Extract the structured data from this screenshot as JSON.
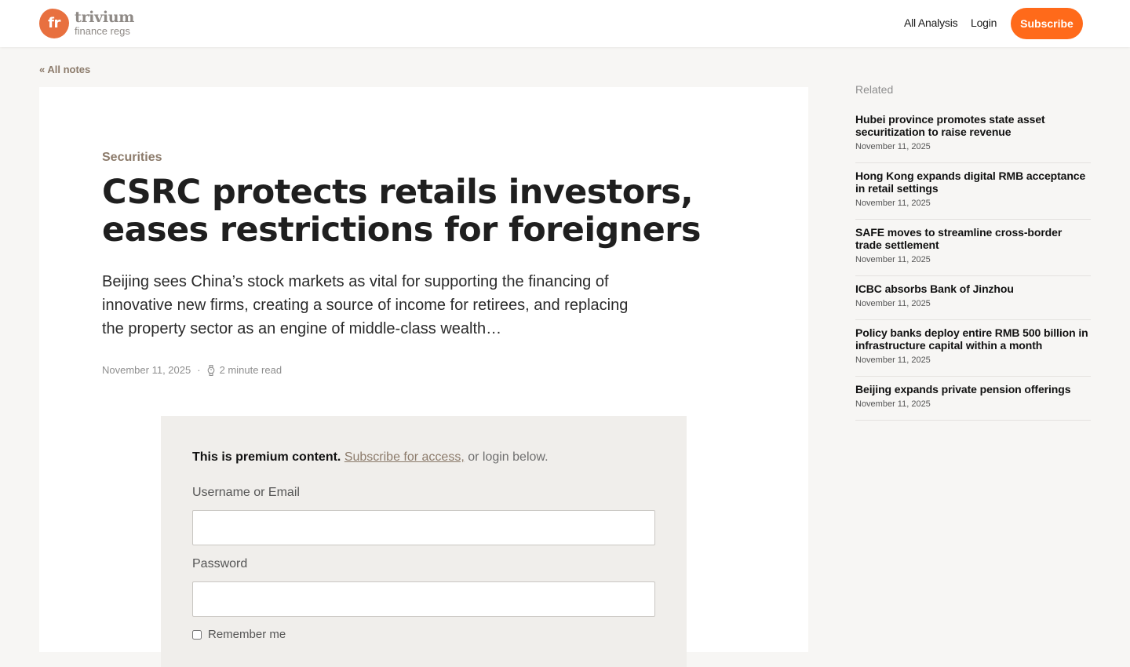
{
  "header": {
    "logo_mark": "fr",
    "logo_name": "trivium",
    "logo_sub": "finance regs",
    "nav": {
      "all_analysis": "All Analysis",
      "login": "Login",
      "subscribe": "Subscribe"
    },
    "accent_color": "#ff6a1a"
  },
  "back_link": "« All notes",
  "article": {
    "category": "Securities",
    "title": "CSRC protects retails investors, eases restrictions for foreigners",
    "summary": "Beijing sees China’s stock markets as vital for supporting the financing of innovative new firms, creating a source of income for retirees, and replacing the property sector as an engine of middle-class wealth…",
    "date": "November 11, 2025",
    "separator": "·",
    "read_time": "2 minute read",
    "read_time_icon": "watch-icon"
  },
  "premium": {
    "lead": "This is premium content.",
    "subscribe_link": "Subscribe for access,",
    "tail": "or login below.",
    "username_label": "Username or Email",
    "username_value": "",
    "password_label": "Password",
    "password_value": "",
    "remember_label": "Remember me"
  },
  "related": {
    "heading": "Related",
    "items": [
      {
        "title": "Hubei province promotes state asset securitization to raise revenue",
        "date": "November 11, 2025"
      },
      {
        "title": "Hong Kong expands digital RMB acceptance in retail settings",
        "date": "November 11, 2025"
      },
      {
        "title": "SAFE moves to streamline cross-border trade settlement",
        "date": "November 11, 2025"
      },
      {
        "title": "ICBC absorbs Bank of Jinzhou",
        "date": "November 11, 2025"
      },
      {
        "title": "Policy banks deploy entire RMB 500 billion in infrastructure capital within a month",
        "date": "November 11, 2025"
      },
      {
        "title": "Beijing expands private pension offerings",
        "date": "November 11, 2025"
      }
    ]
  }
}
